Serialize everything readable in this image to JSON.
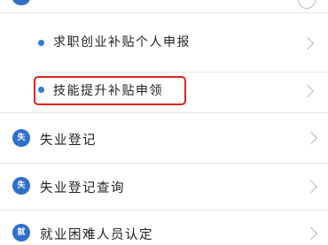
{
  "items": [
    {
      "label": "求职创业补贴个人申报",
      "level": "sub"
    },
    {
      "label": "技能提升补贴申领",
      "level": "sub",
      "highlighted": true
    },
    {
      "label": "失业登记",
      "level": "main",
      "icon_text": "失",
      "icon": "unemployment-icon"
    },
    {
      "label": "失业登记查询",
      "level": "main",
      "icon_text": "失",
      "icon": "unemployment-query-icon"
    },
    {
      "label": "就业困难人员认定",
      "level": "main",
      "icon_text": "就",
      "icon": "employment-difficulty-icon"
    }
  ],
  "colors": {
    "accent": "#2f6fc9",
    "highlight": "#e3231b",
    "chevron": "#b9b9b9"
  }
}
